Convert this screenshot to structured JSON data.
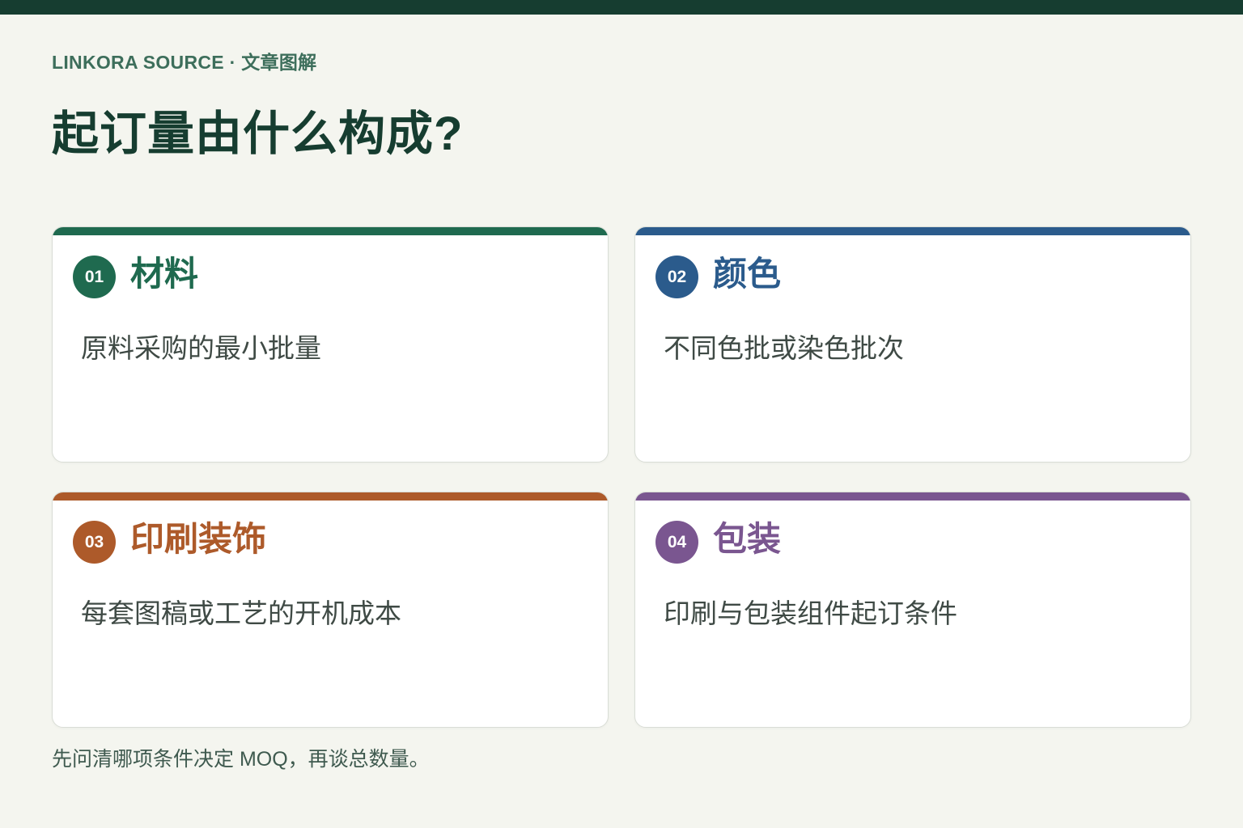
{
  "header": {
    "eyebrow": "LINKORA SOURCE · 文章图解",
    "title": "起订量由什么构成?"
  },
  "colors": {
    "background": "#f4f5ef",
    "top_bar": "#163d30",
    "title": "#163d30"
  },
  "cards": [
    {
      "number": "01",
      "title": "材料",
      "description": "原料采购的最小批量",
      "color": "#1f6a4f"
    },
    {
      "number": "02",
      "title": "颜色",
      "description": "不同色批或染色批次",
      "color": "#2b5b8c"
    },
    {
      "number": "03",
      "title": "印刷装饰",
      "description": "每套图稿或工艺的开机成本",
      "color": "#ad5a2a"
    },
    {
      "number": "04",
      "title": "包装",
      "description": "印刷与包装组件起订条件",
      "color": "#7a5690"
    }
  ],
  "footer": {
    "note": "先问清哪项条件决定 MOQ，再谈总数量。"
  }
}
